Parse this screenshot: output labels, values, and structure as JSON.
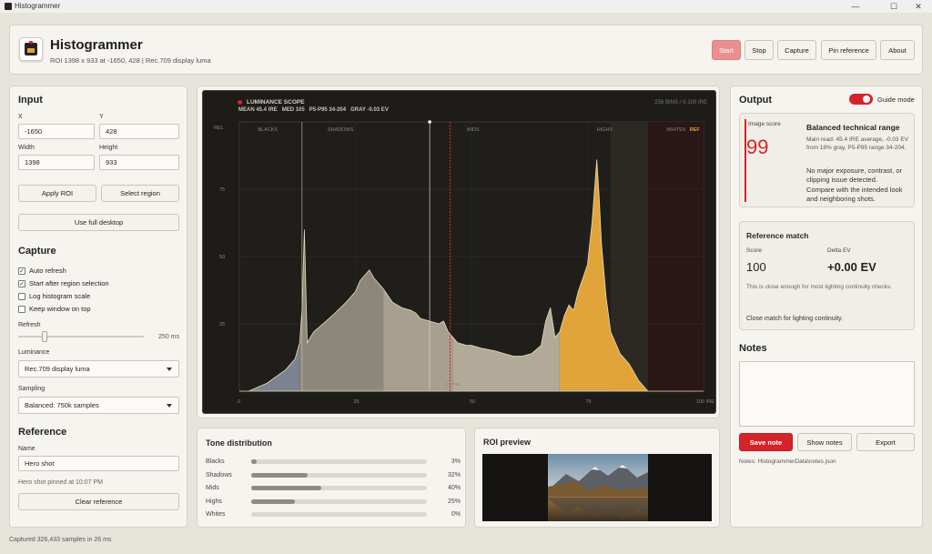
{
  "window": {
    "title": "Histogrammer",
    "min": "—",
    "max": "☐",
    "close": "✕"
  },
  "header": {
    "title": "Histogrammer",
    "subtitle": "ROI 1398 x 933 at -1650, 428  |  Rec.709 display luma",
    "buttons": {
      "start": "Start",
      "stop": "Stop",
      "capture": "Capture",
      "pin": "Pin reference",
      "about": "About"
    }
  },
  "input": {
    "title": "Input",
    "x_label": "X",
    "x_value": "-1650",
    "y_label": "Y",
    "y_value": "428",
    "w_label": "Width",
    "w_value": "1398",
    "h_label": "Height",
    "h_value": "933",
    "apply_roi": "Apply ROI",
    "select_region": "Select region",
    "use_full_desktop": "Use full desktop"
  },
  "capture": {
    "title": "Capture",
    "auto_refresh": "Auto refresh",
    "start_after": "Start after region selection",
    "log_scale": "Log histogram scale",
    "keep_top": "Keep window on top",
    "refresh_label": "Refresh",
    "refresh_value": "250 ms",
    "refresh_level": 0.03,
    "luminance_label": "Luminance",
    "luminance_value": "Rec.709 display luma",
    "sampling_label": "Sampling",
    "sampling_value": "Balanced: 750k samples"
  },
  "reference": {
    "title": "Reference",
    "name_label": "Name",
    "name_value": "Hero shot",
    "pinned_text": "Hero shot pinned at 10:07 PM",
    "clear": "Clear reference"
  },
  "status": "Captured 326,433 samples in 26 ms",
  "scope": {
    "title": "LUMINANCE SCOPE",
    "mean": "MEAN 45.4 IRE",
    "med": "MED 105",
    "p5p95": "P5-P95 34-204",
    "gray": "GRAY -0.03 EV",
    "bins": "256 BINS / 0-100 IRE",
    "rel": "REL",
    "zones": {
      "blacks": "BLACKS",
      "shadows": "SHADOWS",
      "mids": "MIDS",
      "highs": "HIGHS",
      "whites": "WHITES"
    },
    "ref_badge": "REF",
    "p5p95_marker": "P5-P95",
    "y_ticks": [
      "75",
      "50",
      "25"
    ],
    "x_ticks": [
      "0",
      "25",
      "50",
      "75",
      "100 IRE"
    ]
  },
  "tone": {
    "title": "Tone distribution",
    "rows": [
      {
        "name": "Blacks",
        "pct": "3%",
        "value": 3
      },
      {
        "name": "Shadows",
        "pct": "32%",
        "value": 32
      },
      {
        "name": "Mids",
        "pct": "40%",
        "value": 40
      },
      {
        "name": "Highs",
        "pct": "25%",
        "value": 25
      },
      {
        "name": "Whites",
        "pct": "0%",
        "value": 0
      }
    ]
  },
  "roi": {
    "title": "ROI preview"
  },
  "output": {
    "title": "Output",
    "guide_mode": "Guide mode",
    "score_label": "Image score",
    "score": "99",
    "verdict": "Balanced technical range",
    "main_read": "Main read: 45.4 IRE average, -0.03 EV from 18% gray, P5-P95 range 34-204.",
    "note1": "No major exposure, contrast, or clipping issue detected.",
    "note2": "Compare with the intended look and neighboring shots.",
    "ref_title": "Reference match",
    "ref_score_label": "Score",
    "ref_score": "100",
    "ref_delta_label": "Delta EV",
    "ref_delta": "+0.00 EV",
    "ref_desc": "This is close enough for most lighting continuity checks.",
    "ref_close": "Close match for lighting continuity."
  },
  "notes": {
    "title": "Notes",
    "save": "Save note",
    "show": "Show notes",
    "export": "Export",
    "path": "Notes: HistogrammerData\\notes.json"
  },
  "colors": {
    "accent": "#d6232a",
    "highs": "#e0a43a",
    "mids": "#a8a08f",
    "scope_bg": "#1d1c19"
  }
}
